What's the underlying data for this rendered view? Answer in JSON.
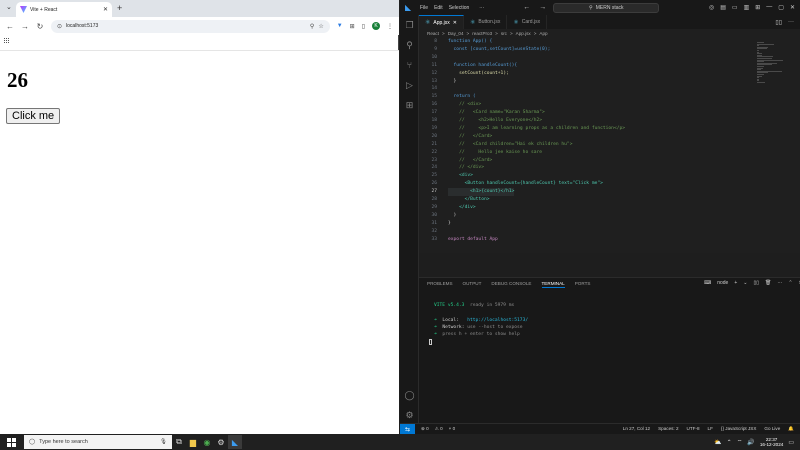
{
  "browser": {
    "tab_title": "Vite + React",
    "url": "localhost:5173",
    "avatar_letter": "K",
    "count": "26",
    "button_label": "Click me"
  },
  "vscode": {
    "menus": [
      "File",
      "Edit",
      "Selection"
    ],
    "command_center": "MERN stack",
    "tabs": [
      "App.jsx",
      "Button.jsx",
      "Card.jsx"
    ],
    "breadcrumb": [
      "React",
      ">",
      "Day_04",
      ">",
      "reactPro3",
      ">",
      "src",
      ">",
      "App.jsx",
      ">",
      "App"
    ],
    "line_numbers": [
      "8",
      "9",
      "10",
      "11",
      "12",
      "13",
      "14",
      "15",
      "16",
      "17",
      "18",
      "19",
      "20",
      "21",
      "22",
      "23",
      "24",
      "25",
      "26",
      "27",
      "28",
      "29",
      "30",
      "31",
      "32",
      "33"
    ],
    "code": [
      "function App() {",
      "  const [count,setCount]=useState(0);",
      "",
      "  function handleCount(){",
      "    setCount(count+1);",
      "  }",
      "",
      "  return (",
      "    // <div>",
      "    //   <Card name=\"Karan Sharma\">",
      "    //     <h2>Hello Everyone</h2>",
      "    //     <p>I am learning props as a children and function</p>",
      "    //   </Card>",
      "    //   <Card children=\"Hai ek children hu\">",
      "    //     Hello jee kaise ho sare",
      "    //   </Card>",
      "    // </div>",
      "    <div>",
      "      <Button handleCount={handleCount} text=\"Click me\">",
      "        <h1>{count}</h1>",
      "      </Button>",
      "    </div>",
      "  )",
      "}",
      "",
      "export default App"
    ],
    "panel_tabs": [
      "PROBLEMS",
      "OUTPUT",
      "DEBUG CONSOLE",
      "TERMINAL",
      "PORTS"
    ],
    "terminal_kind": "node",
    "terminal": {
      "vite_version": "VITE v5.4.3",
      "ready": "ready in 5979 ms",
      "local_label": "Local:",
      "local_url": "http://localhost:5173/",
      "network_label": "Network:",
      "network_text": "use --host to expose",
      "help": "press h + enter to show help"
    },
    "status_left": [
      "⊗ 0",
      "⚠ 0",
      "⑂ 0"
    ],
    "status_right": [
      "Ln 27, Col 12",
      "Spaces: 2",
      "UTF-8",
      "LF",
      "{} JavaScript JSX",
      "Go Live"
    ]
  },
  "taskbar": {
    "search_placeholder": "Type here to search",
    "time": "22:37",
    "date": "16-12-2024"
  },
  "colors": {
    "vscode_accent": "#0078d4",
    "terminal_green": "#23d18b",
    "terminal_cyan": "#29b8db"
  }
}
